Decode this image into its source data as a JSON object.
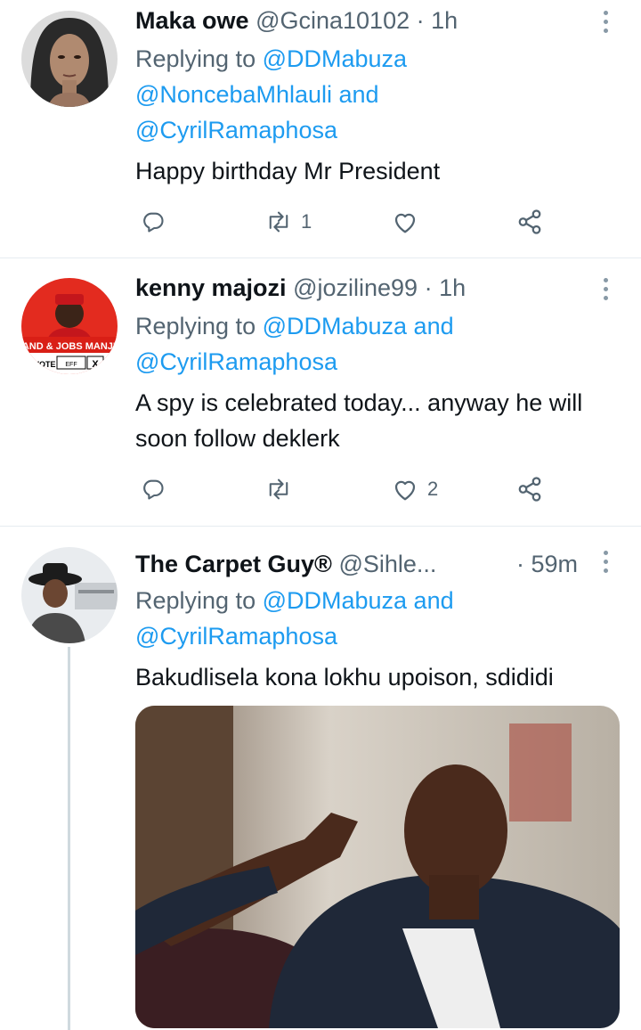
{
  "tweets": [
    {
      "name": "Maka owe",
      "handle": "@Gcina10102",
      "time": "· 1h",
      "replying_lines": [
        {
          "prefix": "Replying to ",
          "mention": "@DDMabuza"
        },
        {
          "prefix": "",
          "mention": "@NoncebaMhlauli and"
        },
        {
          "prefix": "",
          "mention": "@CyrilRamaphosa"
        }
      ],
      "text": "Happy birthday Mr President",
      "retweets": "1",
      "likes": ""
    },
    {
      "name": "kenny majozi",
      "handle": "@joziline99",
      "time": "· 1h",
      "replying_lines": [
        {
          "prefix": "Replying to ",
          "mention": "@DDMabuza and"
        },
        {
          "prefix": "",
          "mention": "@CyrilRamaphosa"
        }
      ],
      "text": "A spy is celebrated today... anyway he will soon follow deklerk",
      "retweets": "",
      "likes": "2",
      "avatar_banner": "LAND & JOBS MANJE!",
      "avatar_vote": "VOTE",
      "avatar_party": "EFF",
      "avatar_mark": "X"
    },
    {
      "name": "The Carpet Guy®",
      "handle": "@Sihle...",
      "time": "· 59m",
      "replying_lines": [
        {
          "prefix": "Replying to ",
          "mention": "@DDMabuza and"
        },
        {
          "prefix": "",
          "mention": "@CyrilRamaphosa"
        }
      ],
      "text": "Bakudlisela kona lokhu upoison, sdididi"
    }
  ],
  "icons": {
    "reply": "reply-icon",
    "retweet": "retweet-icon",
    "like": "heart-icon",
    "share": "share-icon",
    "more": "more-vertical-icon"
  },
  "colors": {
    "link": "#1d9bf0",
    "secondary": "#536471",
    "text": "#0f1419",
    "divider": "#e6ecf0"
  }
}
